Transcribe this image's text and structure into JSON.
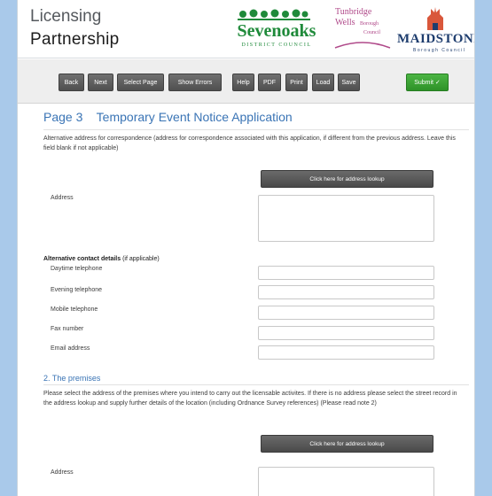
{
  "header": {
    "brand_line1": "Licensing",
    "brand_line2": "Partnership",
    "logos": {
      "sevenoaks": {
        "name": "Sevenoaks",
        "sub": "DISTRICT COUNCIL"
      },
      "tunbridge": {
        "line1": "Tunbridge",
        "line2": "Wells",
        "line3": "Borough",
        "line4": "Council"
      },
      "maidstone": {
        "name": "MAIDSTONE",
        "sub": "Borough Council"
      }
    }
  },
  "toolbar": {
    "back": "Back",
    "next": "Next",
    "select_page": "Select Page",
    "show_errors": "Show Errors",
    "help": "Help",
    "pdf": "PDF",
    "print": "Print",
    "load": "Load",
    "save": "Save",
    "submit": "Submit ✓"
  },
  "page": {
    "title": "Page 3    Temporary Event Notice Application",
    "alt_address_note": "Alternative address for correspondence (address for correspondence associated with this application, if different from the previous address. Leave this field blank if not applicable)",
    "lookup_button": "Click here for address lookup",
    "address_label": "Address",
    "alt_contact_bold": "Alternative contact details",
    "alt_contact_suffix": " (if applicable)",
    "daytime_telephone": "Daytime telephone",
    "evening_telephone": "Evening telephone",
    "mobile_telephone": "Mobile telephone",
    "fax_number": "Fax number",
    "email_address": "Email address",
    "section2_title": "2. The premises",
    "premises_note": "Please select the address of the premises where you intend to carry out the licensable activites. If there is no address please select the street record in the address lookup and supply further details of the location (including Ordnance Survey references) (Please read note 2)",
    "lookup_button_2": "Click here for address lookup",
    "address_label_2": "Address"
  },
  "colors": {
    "background": "#a9c9ea",
    "heading_blue": "#3a74b5",
    "submit_green": "#3aa535",
    "sevenoaks_green": "#1f8a3a",
    "tunbridge_magenta": "#b04a8a",
    "maidstone_navy": "#1e3d6e"
  }
}
